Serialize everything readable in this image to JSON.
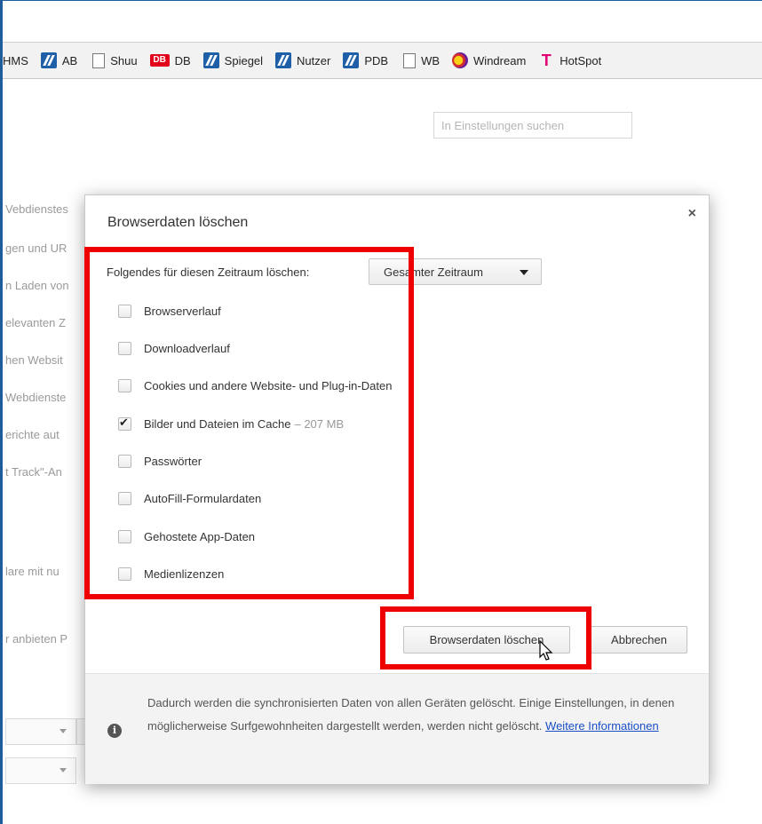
{
  "bookmarks": [
    {
      "label": "HMS",
      "icon": "none-icon"
    },
    {
      "label": "AB",
      "icon": "blue-bookmark-icon"
    },
    {
      "label": "Shuu",
      "icon": "page-icon"
    },
    {
      "label": "DB",
      "icon": "db-logo-icon",
      "badge": "DB"
    },
    {
      "label": "Spiegel",
      "icon": "blue-bookmark-icon"
    },
    {
      "label": "Nutzer",
      "icon": "blue-bookmark-icon"
    },
    {
      "label": "PDB",
      "icon": "blue-bookmark-icon"
    },
    {
      "label": "WB",
      "icon": "page-icon"
    },
    {
      "label": "Windream",
      "icon": "windream-icon"
    },
    {
      "label": "HotSpot",
      "icon": "telekom-icon",
      "glyph": "T"
    }
  ],
  "settings": {
    "search_placeholder": "In Einstellungen suchen",
    "background_lines": [
      "Vebdienstes",
      "gen und UR",
      "n Laden von",
      "elevanten Z",
      "hen Websit",
      "Webdienste",
      "erichte aut",
      "t Track\"-An",
      "lare mit nu",
      "r anbieten P"
    ]
  },
  "dialog": {
    "title": "Browserdaten löschen",
    "close_symbol": "×",
    "period_label": "Folgendes für diesen Zeitraum löschen:",
    "period_value": "Gesamter Zeitraum",
    "options": [
      {
        "label": "Browserverlauf",
        "checked": false
      },
      {
        "label": "Downloadverlauf",
        "checked": false
      },
      {
        "label": "Cookies und andere Website- und Plug-in-Daten",
        "checked": false
      },
      {
        "label": "Bilder und Dateien im Cache",
        "checked": true,
        "note": "–  207 MB"
      },
      {
        "label": "Passwörter",
        "checked": false
      },
      {
        "label": "AutoFill-Formulardaten",
        "checked": false
      },
      {
        "label": "Gehostete App-Daten",
        "checked": false
      },
      {
        "label": "Medienlizenzen",
        "checked": false
      }
    ],
    "clear_button": "Browserdaten löschen",
    "cancel_button": "Abbrechen",
    "footer_text": "Dadurch werden die synchronisierten Daten von allen Geräten gelöscht. Einige Einstellungen, in denen möglicherweise Surfgewohnheiten dargestellt werden, werden nicht gelöscht.",
    "footer_link": "Weitere Informationen",
    "info_glyph": "i"
  },
  "colors": {
    "highlight": "#ee0000",
    "link": "#1a4ec7",
    "window_border": "#1f5c99"
  }
}
